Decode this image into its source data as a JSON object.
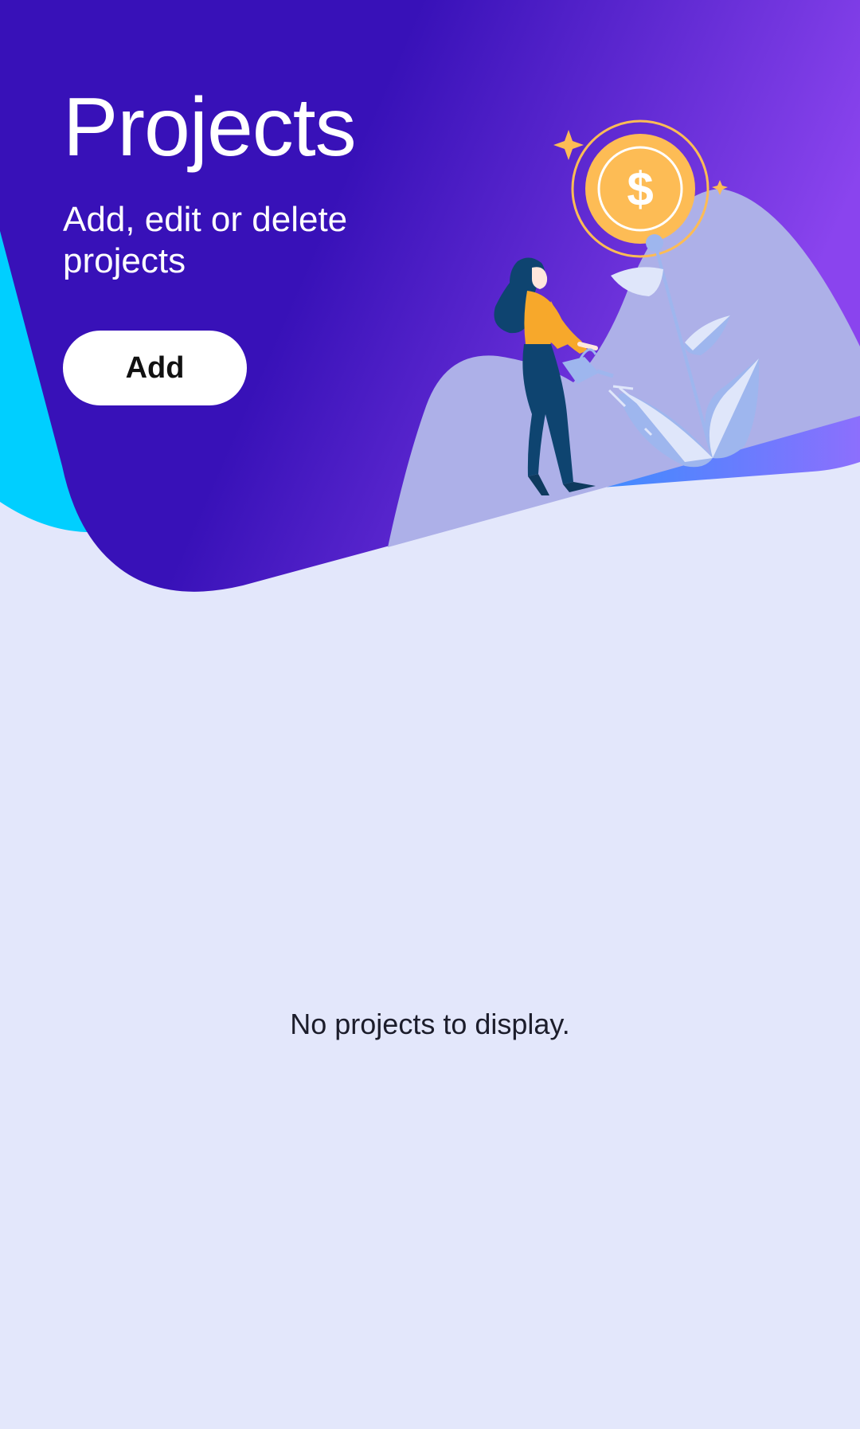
{
  "header": {
    "title": "Projects",
    "subtitle": "Add, edit or delete projects",
    "add_label": "Add"
  },
  "illustration": {
    "icon": "woman-watering-money-plant-illustration",
    "coin_symbol": "$"
  },
  "content": {
    "empty_message": "No projects to display."
  },
  "colors": {
    "header_background": "#3811b8",
    "header_gradient_end": "#8a44ee",
    "accent_cyan": "#00cfff",
    "page_background": "#e3e7fb",
    "coin": "#fdbc55",
    "button_background": "#ffffff"
  }
}
